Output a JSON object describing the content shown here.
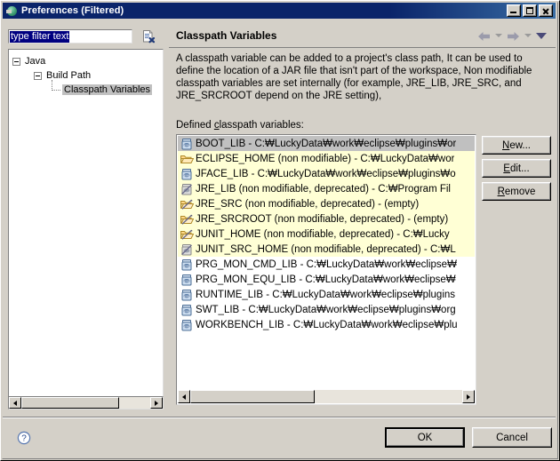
{
  "window": {
    "title": "Preferences (Filtered)",
    "icon": "preferences-globe-icon",
    "min_label": "Minimize",
    "max_label": "Maximize",
    "close_label": "Close"
  },
  "filter": {
    "value": "type filter text",
    "placeholder": "type filter text",
    "clear_icon": "clear-filter-icon"
  },
  "tree": {
    "items": [
      {
        "label": "Java",
        "level": 0,
        "expanded": true,
        "selected": false
      },
      {
        "label": "Build Path",
        "level": 1,
        "expanded": true,
        "selected": false
      },
      {
        "label": "Classpath Variables",
        "level": 2,
        "expanded": false,
        "selected": true
      }
    ]
  },
  "page": {
    "title": "Classpath Variables",
    "description": "A classpath variable can be added to a project's class path, It can be used to define the location of a JAR file that isn't part of the workspace, Non modifiable classpath variables are set internally (for example, JRE_LIB, JRE_SRC, and JRE_SRCROOT depend on the JRE setting),",
    "list_label_pre": "Defined ",
    "list_label_mnemonic": "c",
    "list_label_post": "lasspath variables:"
  },
  "nav": {
    "back_icon": "arrow-left-icon",
    "back_menu_icon": "chevron-down-icon",
    "forward_icon": "arrow-right-icon",
    "forward_menu_icon": "chevron-down-icon",
    "menu_icon": "chevron-down-filled-icon"
  },
  "variables": [
    {
      "icon": "jar-variable-icon",
      "text": "BOOT_LIB - C:₩LuckyData₩work₩eclipse₩plugins₩or",
      "state": "selected"
    },
    {
      "icon": "folder-open-icon",
      "text": "ECLIPSE_HOME (non modifiable) - C:₩LuckyData₩wor",
      "state": "warn"
    },
    {
      "icon": "jar-variable-icon",
      "text": "JFACE_LIB - C:₩LuckyData₩work₩eclipse₩plugins₩o",
      "state": "warn"
    },
    {
      "icon": "jar-deprecated-icon",
      "text": "JRE_LIB (non modifiable, deprecated) - C:₩Program Fil",
      "state": "warn"
    },
    {
      "icon": "folder-deprecated-icon",
      "text": "JRE_SRC (non modifiable, deprecated) - (empty)",
      "state": "warn"
    },
    {
      "icon": "folder-deprecated-icon",
      "text": "JRE_SRCROOT (non modifiable, deprecated) - (empty)",
      "state": "warn"
    },
    {
      "icon": "folder-deprecated-icon",
      "text": "JUNIT_HOME (non modifiable, deprecated) - C:₩Lucky",
      "state": "warn"
    },
    {
      "icon": "jar-deprecated-icon",
      "text": "JUNIT_SRC_HOME (non modifiable, deprecated) - C:₩L",
      "state": "warn"
    },
    {
      "icon": "jar-variable-icon",
      "text": "PRG_MON_CMD_LIB - C:₩LuckyData₩work₩eclipse₩",
      "state": "normal"
    },
    {
      "icon": "jar-variable-icon",
      "text": "PRG_MON_EQU_LIB - C:₩LuckyData₩work₩eclipse₩",
      "state": "normal"
    },
    {
      "icon": "jar-variable-icon",
      "text": "RUNTIME_LIB - C:₩LuckyData₩work₩eclipse₩plugins",
      "state": "normal"
    },
    {
      "icon": "jar-variable-icon",
      "text": "SWT_LIB - C:₩LuckyData₩work₩eclipse₩plugins₩org",
      "state": "normal"
    },
    {
      "icon": "jar-variable-icon",
      "text": "WORKBENCH_LIB - C:₩LuckyData₩work₩eclipse₩plu",
      "state": "normal"
    }
  ],
  "side_buttons": {
    "new": {
      "pre": "",
      "mnemonic": "N",
      "post": "ew..."
    },
    "edit": {
      "pre": "",
      "mnemonic": "E",
      "post": "dit..."
    },
    "remove": {
      "pre": "",
      "mnemonic": "R",
      "post": "emove"
    }
  },
  "bottom": {
    "help_icon": "help-question-icon",
    "ok_label": "OK",
    "cancel_label": "Cancel"
  },
  "scrollbars": {
    "left_arrow_icon": "arrow-left-icon",
    "right_arrow_icon": "arrow-right-icon"
  },
  "colors": {
    "titlebar": "#0a246a",
    "face": "#d4d0c8",
    "selection": "#000080",
    "row_selected": "#c0c0c0",
    "row_warning": "#ffffd5"
  }
}
